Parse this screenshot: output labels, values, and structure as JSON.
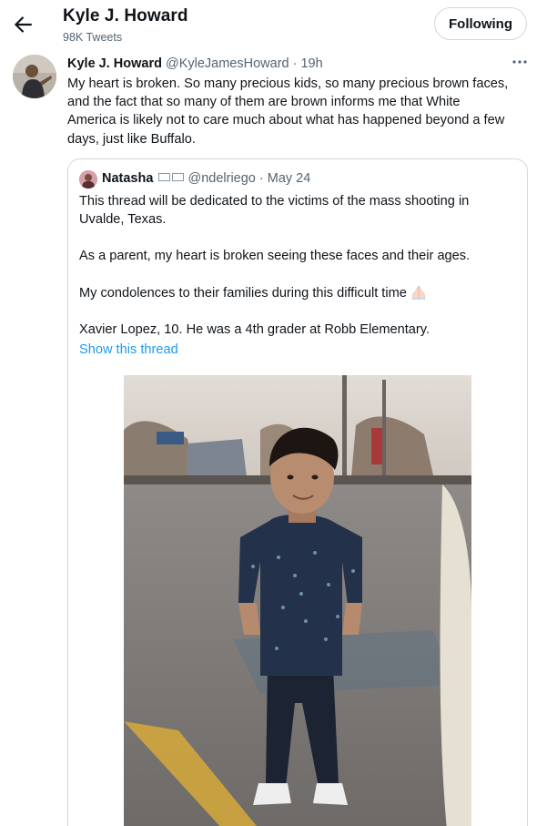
{
  "header": {
    "back_icon": "arrow-left-icon",
    "profile_name": "Kyle J. Howard",
    "tweet_count": "98K Tweets",
    "follow_label": "Following"
  },
  "tweet": {
    "author_name": "Kyle J. Howard",
    "author_handle": "@KyleJamesHoward",
    "separator": " · ",
    "time": "19h",
    "more_icon": "more-horizontal-icon",
    "lines": [
      "My heart is broken. So many precious kids, so many precious brown faces,",
      "and the fact that so many of them are brown informs me that White",
      "America is likely not to care much about what has happened beyond a few",
      "days, just like Buffalo."
    ]
  },
  "quote": {
    "author_name": "Natasha",
    "author_handle": "@ndelriego",
    "separator": " · ",
    "date": "May 24",
    "paragraphs": [
      "This thread will be dedicated to the victims of the mass shooting in Uvalde, Texas.",
      "As a parent, my heart is broken seeing these faces and their ages.",
      "My condolences to their families during this difficult time",
      "Xavier Lopez, 10. He was a 4th grader at Robb Elementary."
    ],
    "praying_icon": "folded-hands-icon",
    "show_thread": "Show this thread"
  },
  "colors": {
    "text_primary": "#0f1419",
    "text_secondary": "#536471",
    "link": "#1d9bf0",
    "border": "#cfd9de"
  }
}
